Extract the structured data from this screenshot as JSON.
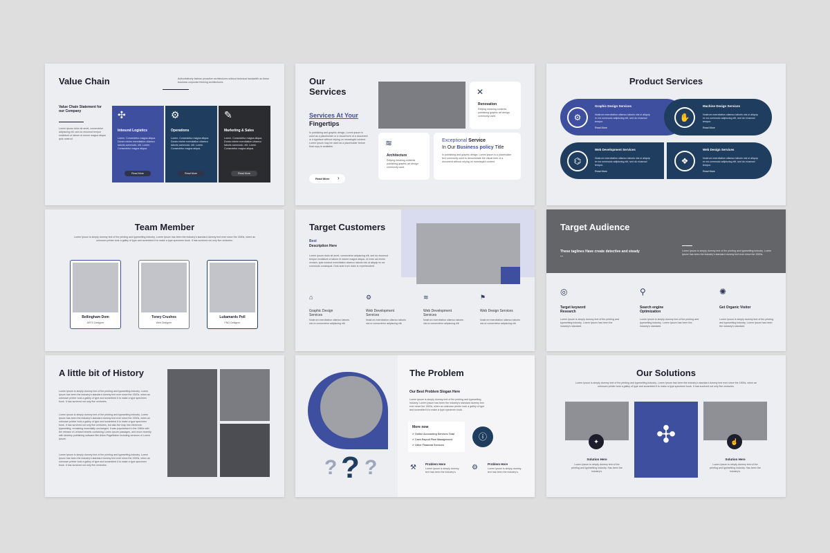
{
  "s1": {
    "title": "Value Chain",
    "intro": "Authoritatively fashion proactive architectures without technical bandwidth as these business corporate thinking architectures.",
    "statement": "Value Chain Statement for our Company",
    "body": "Lorem ipsum dolor sit amet, consectetur adipiscing elit, sed do eiusmod tempor incididunt ut labore et dolore magna aliqua quis nostrud.",
    "cols": [
      {
        "title": "Inbound Logistics",
        "text": "Lorem. Consectetur magna aliqua. Donec minim exercitation ullamco laboris commodo. elit. Lorem. Consectetur magna aliqua.",
        "btn": "Read More"
      },
      {
        "title": "Operations",
        "text": "Lorem. Consectetur magna aliqua. Donec minim exercitation ullamco laboris commodo. elit. Lorem. Consectetur magna aliqua.",
        "btn": "Read More"
      },
      {
        "title": "Marketing & Sales",
        "text": "Lorem. Consectetur magna aliqua. Donec minim exercitation ullamco laboris commodo. elit. Lorem. Consectetur magna aliqua.",
        "btn": "Read More"
      }
    ]
  },
  "s2": {
    "title1": "Our",
    "title2": "Services",
    "sub1": "Services At Your",
    "sub2": "Fingertips",
    "body": "In publishing and graphic design, Lorem ipsum is used as a placeholder or a visual form of a document or a typeface without relying on meaningful content. Lorem ipsum may be used as a placeholder before final copy is available.",
    "btn": "Read More",
    "renovation": "Renovation",
    "renovation_text": "Relying meaning contents publishing graphic art design commonly used.",
    "architecture": "Architecture",
    "architecture_text": "Relying meaning contents publishing graphic art design commonly used.",
    "ex1": "Exceptional",
    "ex2": "Service",
    "ex3": "In Our",
    "ex4": "Business policy",
    "ex5": "Title",
    "ex_text": "In publishing and graphic design, Lorem ipsum is a placeholder text commonly used to demonstrate the visual form of a document without relying on meaningful content."
  },
  "s3": {
    "title": "Product Services",
    "items": [
      {
        "title": "Graphic Design Services",
        "text": "Nostrum exercitation ullamco laboris nisi ut aliquip ex ea commodo adipiscing elit, sed do eiusmod tempor.",
        "link": "Read More"
      },
      {
        "title": "Machine Design Services",
        "text": "Nostrum exercitation ullamco laboris nisi ut aliquip ex ea commodo adipiscing elit, sed do eiusmod tempor.",
        "link": "Read More"
      },
      {
        "title": "Web Development Services",
        "text": "Nostrum exercitation ullamco laboris nisi ut aliquip ex ea commodo adipiscing elit, sed do eiusmod tempor.",
        "link": "Read More"
      },
      {
        "title": "Web Design Services",
        "text": "Nostrum exercitation ullamco laboris nisi ut aliquip ex ea commodo adipiscing elit, sed do eiusmod tempor.",
        "link": "Read More"
      }
    ]
  },
  "s4": {
    "title": "Team Member",
    "intro": "Lorem Ipsum is simply dummy text of the printing and typesetting industry. Lorem Ipsum has been the industry's standard dummy text ever since the 1500s, when an unknown printer took a galley of type and scrambled it to make a type specimen book. It has survived not only five centuries.",
    "members": [
      {
        "name": "Bellingham Dom",
        "role": "ARTX Designer"
      },
      {
        "name": "Toney Crushes",
        "role": "Web Designer"
      },
      {
        "name": "Lukamards Poll",
        "role": "FNO Designer"
      }
    ]
  },
  "s5": {
    "title": "Target Customers",
    "best": "Best",
    "desc": "Description Here",
    "body": "Lorem ipsum dolor sit amet, consectetur adipiscing elit, sed do eiusmod tempor incididunt ut labore et dolore magna aliqua. Ut enim ad minim veniam, quis nostrud exercitation ullamco laboris nisi ut aliquip ex ea commodo consequat. Duis aute irure dolor in reprehenderit.",
    "items": [
      {
        "title": "Graphic Design Services",
        "text": "Nostrum exercitation ullamco laboris nisi ut consectetur adipiscing elit."
      },
      {
        "title": "Web Development Services",
        "text": "Nostrum exercitation ullamco laboris nisi ut consectetur adipiscing elit."
      },
      {
        "title": "Web Development Services",
        "text": "Nostrum exercitation ullamco laboris nisi ut consectetur adipiscing elit."
      },
      {
        "title": "Web Design Services",
        "text": "Nostrum exercitation ullamco laboris nisi ut consectetur adipiscing elit."
      }
    ]
  },
  "s6": {
    "title": "Target Audience",
    "tagline": "These taglines Have create detective and steady ...",
    "side": "Lorem Ipsum is simply dummy text of the printing and typesetting industry. Lorem Ipsum has been the industry's standard dummy text ever since the 1500s.",
    "items": [
      {
        "title": "Target keyword Research",
        "text": "Lorem Ipsum is simply dummy text of the printing and typesetting industry. Lorem Ipsum has been the industry's standard."
      },
      {
        "title": "Search engine Optimization",
        "text": "Lorem Ipsum is simply dummy text of the printing and typesetting industry. Lorem Ipsum has been the industry's standard."
      },
      {
        "title": "Get Organic Visitor",
        "text": "Lorem Ipsum is simply dummy text of the printing and typesetting industry. Lorem Ipsum has been the industry's standard."
      }
    ]
  },
  "s7": {
    "title": "A little bit of History",
    "p1": "Lorem Ipsum is simply dummy text of the printing and typesetting industry. Lorem Ipsum has been the industry's standard dummy text ever since the 1500s, when an unknown printer took a galley of type and scrambled it to make a type specimen book. It has survived not only five centuries.",
    "p2": "Lorem Ipsum is simply dummy text of the printing and typesetting industry. Lorem Ipsum has been the industry's standard dummy text ever since the 1500s, when an unknown printer took a galley of type and scrambled it to make a type specimen book. It has survived not only five centuries, but also the leap into electronic typesetting, remaining essentially unchanged. It was popularised in the 1960s with the release of Letraset sheets containing Lorem Ipsum passages, and more recently with desktop publishing software like Aldus PageMaker including versions of Lorem Ipsum.",
    "p3": "Lorem Ipsum is simply dummy text of the printing and typesetting industry. Lorem Ipsum has been the industry's standard dummy text ever since the 1500s, when an unknown printer took a galley of type and scrambled it to make a type specimen book. It has survived not only five centuries."
  },
  "s8": {
    "title": "The Problem",
    "slogan": "Our Best Problem Slogan Here",
    "body": "Lorem Ipsum is simply dummy text of the printing and typesetting industry. Lorem Ipsum has been the industry's standard dummy text ever since the 1500s, when an unknown printer took a galley of type and scrambled it to make a type specimen book.",
    "more": "More now",
    "list": [
      "Online Accounting Services Total",
      "Cash Payroll Flow Management",
      "Other Financial Services"
    ],
    "p1_title": "Problem Here",
    "p1_text": "Lorem Ipsum is simply dummy text has been the industry's.",
    "p2_title": "Problem Here",
    "p2_text": "Lorem Ipsum is simply dummy text has been the industry's."
  },
  "s9": {
    "title": "Our Solutions",
    "intro": "Lorem Ipsum is simply dummy text of the printing and typesetting industry. Lorem Ipsum has been the industry's standard dummy text ever since the 1500s, when an unknown printer took a galley of type and scrambled it to make a type specimen book. It has survived not only five centuries.",
    "s1_title": "Solution Here",
    "s1_text": "Lorem Ipsum is simply dummy text of the printing and typesetting industry. Has been the industry's.",
    "s2_title": "Solution Here",
    "s2_text": "Lorem Ipsum is simply dummy text of the printing and typesetting industry. Has been the industry's."
  }
}
